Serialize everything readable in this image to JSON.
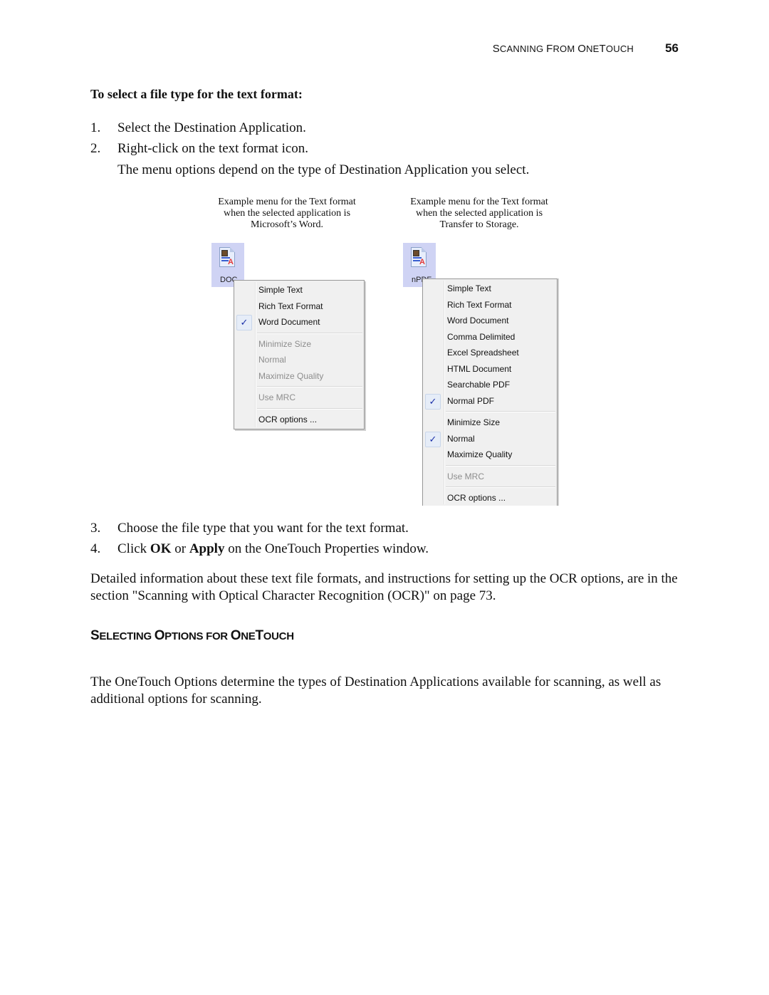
{
  "running_head": {
    "section_parts": [
      {
        "cap": "S",
        "rest": "CANNING "
      },
      {
        "cap": "F",
        "rest": "ROM "
      },
      {
        "cap": "O",
        "rest": "NE"
      },
      {
        "cap": "T",
        "rest": "OUCH"
      }
    ],
    "page_number": "56"
  },
  "procedure": {
    "heading": "To select a file type for the text format:",
    "steps_before": [
      {
        "num": "1.",
        "text": "Select the Destination Application."
      },
      {
        "num": "2.",
        "text": "Right-click on the text format icon."
      }
    ],
    "note": "The menu options depend on the type of Destination Application you select.",
    "steps_after": [
      {
        "num": "3.",
        "text": "Choose the file type that you want for the text format."
      },
      {
        "num": "4.",
        "pre": "Click ",
        "bold1": "OK",
        "mid": " or ",
        "bold2": "Apply",
        "post": " on the OneTouch Properties window."
      }
    ]
  },
  "figures": [
    {
      "caption": [
        "Example menu for the Text format",
        "when the selected application is",
        "Microsoft’s Word."
      ],
      "icon": {
        "name": "text-format-icon",
        "label": "DOC"
      },
      "menu": [
        {
          "type": "item",
          "label": "Simple Text",
          "checked": false,
          "disabled": false
        },
        {
          "type": "item",
          "label": "Rich Text Format",
          "checked": false,
          "disabled": false
        },
        {
          "type": "item",
          "label": "Word Document",
          "checked": true,
          "disabled": false
        },
        {
          "type": "separator"
        },
        {
          "type": "item",
          "label": "Minimize Size",
          "checked": false,
          "disabled": true
        },
        {
          "type": "item",
          "label": "Normal",
          "checked": false,
          "disabled": true
        },
        {
          "type": "item",
          "label": "Maximize Quality",
          "checked": false,
          "disabled": true
        },
        {
          "type": "separator"
        },
        {
          "type": "item",
          "label": "Use MRC",
          "checked": false,
          "disabled": true
        },
        {
          "type": "separator"
        },
        {
          "type": "item",
          "label": "OCR options ...",
          "checked": false,
          "disabled": false
        }
      ]
    },
    {
      "caption": [
        "Example menu for the Text format",
        "when the selected application is",
        "Transfer to Storage."
      ],
      "icon": {
        "name": "text-format-icon",
        "label": "nPDF"
      },
      "menu": [
        {
          "type": "item",
          "label": "Simple Text",
          "checked": false,
          "disabled": false
        },
        {
          "type": "item",
          "label": "Rich Text Format",
          "checked": false,
          "disabled": false
        },
        {
          "type": "item",
          "label": "Word Document",
          "checked": false,
          "disabled": false
        },
        {
          "type": "item",
          "label": "Comma Delimited",
          "checked": false,
          "disabled": false
        },
        {
          "type": "item",
          "label": "Excel Spreadsheet",
          "checked": false,
          "disabled": false
        },
        {
          "type": "item",
          "label": "HTML Document",
          "checked": false,
          "disabled": false
        },
        {
          "type": "item",
          "label": "Searchable PDF",
          "checked": false,
          "disabled": false
        },
        {
          "type": "item",
          "label": "Normal PDF",
          "checked": true,
          "disabled": false
        },
        {
          "type": "separator"
        },
        {
          "type": "item",
          "label": "Minimize Size",
          "checked": false,
          "disabled": false
        },
        {
          "type": "item",
          "label": "Normal",
          "checked": true,
          "disabled": false
        },
        {
          "type": "item",
          "label": "Maximize Quality",
          "checked": false,
          "disabled": false
        },
        {
          "type": "separator"
        },
        {
          "type": "item",
          "label": "Use MRC",
          "checked": false,
          "disabled": true
        },
        {
          "type": "separator"
        },
        {
          "type": "item",
          "label": "OCR options ...",
          "checked": false,
          "disabled": false
        }
      ]
    }
  ],
  "detail_paragraph": "Detailed information about these text file formats, and instructions for setting up the OCR options, are in the section \"Scanning with Optical Character Recognition (OCR)\" on page 73.",
  "section": {
    "heading_parts": [
      {
        "cap": "S",
        "rest": "ELECTING "
      },
      {
        "cap": "O",
        "rest": "PTIONS FOR "
      },
      {
        "cap": "O",
        "rest": "NE"
      },
      {
        "cap": "T",
        "rest": "OUCH"
      }
    ],
    "body": "The OneTouch Options determine the types of Destination Applications available for scanning, as well as additional options for scanning."
  },
  "icons": {
    "check": "✓"
  }
}
